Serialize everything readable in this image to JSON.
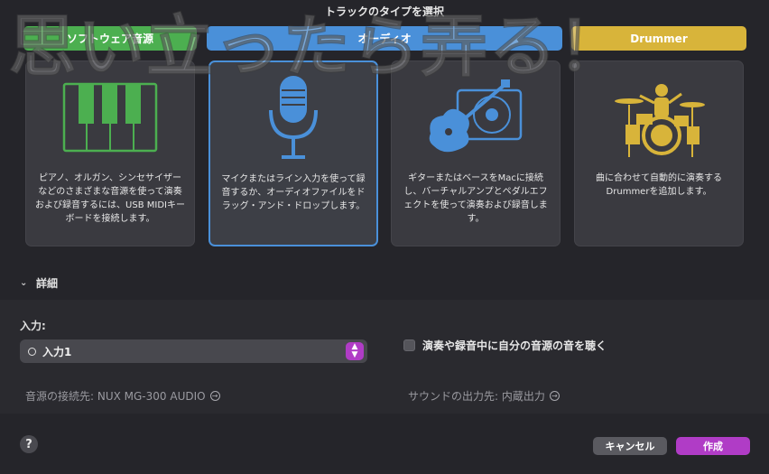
{
  "window": {
    "title": "トラックのタイプを選択"
  },
  "watermark": {
    "text": "思い立ったら弄る！"
  },
  "tabs": [
    {
      "label": "ソフトウェア音源",
      "color": "#4caf50"
    },
    {
      "label": "オーディオ",
      "color": "#4a90d9"
    },
    {
      "label": "Drummer",
      "color": "#d8b43a"
    }
  ],
  "cards": [
    {
      "icon": "piano-keys-icon",
      "desc": "ピアノ、オルガン、シンセサイザーなどのさまざまな音源を使って演奏および録音するには、USB MIDIキーボードを接続します。"
    },
    {
      "icon": "microphone-icon",
      "desc": "マイクまたはライン入力を使って録音するか、オーディオファイルをドラッグ・アンド・ドロップします。"
    },
    {
      "icon": "guitar-amp-icon",
      "desc": "ギターまたはベースをMacに接続し、バーチャルアンプとペダルエフェクトを使って演奏および録音します。"
    },
    {
      "icon": "drummer-icon",
      "desc": "曲に合わせて自動的に演奏するDrummerを追加します。"
    }
  ],
  "details": {
    "label": "詳細"
  },
  "input": {
    "label": "入力:",
    "value": "入力1"
  },
  "monitor": {
    "label": "演奏や録音中に自分の音源の音を聴く",
    "checked": false
  },
  "connection": {
    "source": "音源の接続先: NUX MG-300 AUDIO",
    "output": "サウンドの出力先: 内蔵出力"
  },
  "footer": {
    "help": "?",
    "cancel": "キャンセル",
    "create": "作成"
  },
  "colors": {
    "accent": "#b03cc6",
    "selection": "#4a90d9"
  }
}
